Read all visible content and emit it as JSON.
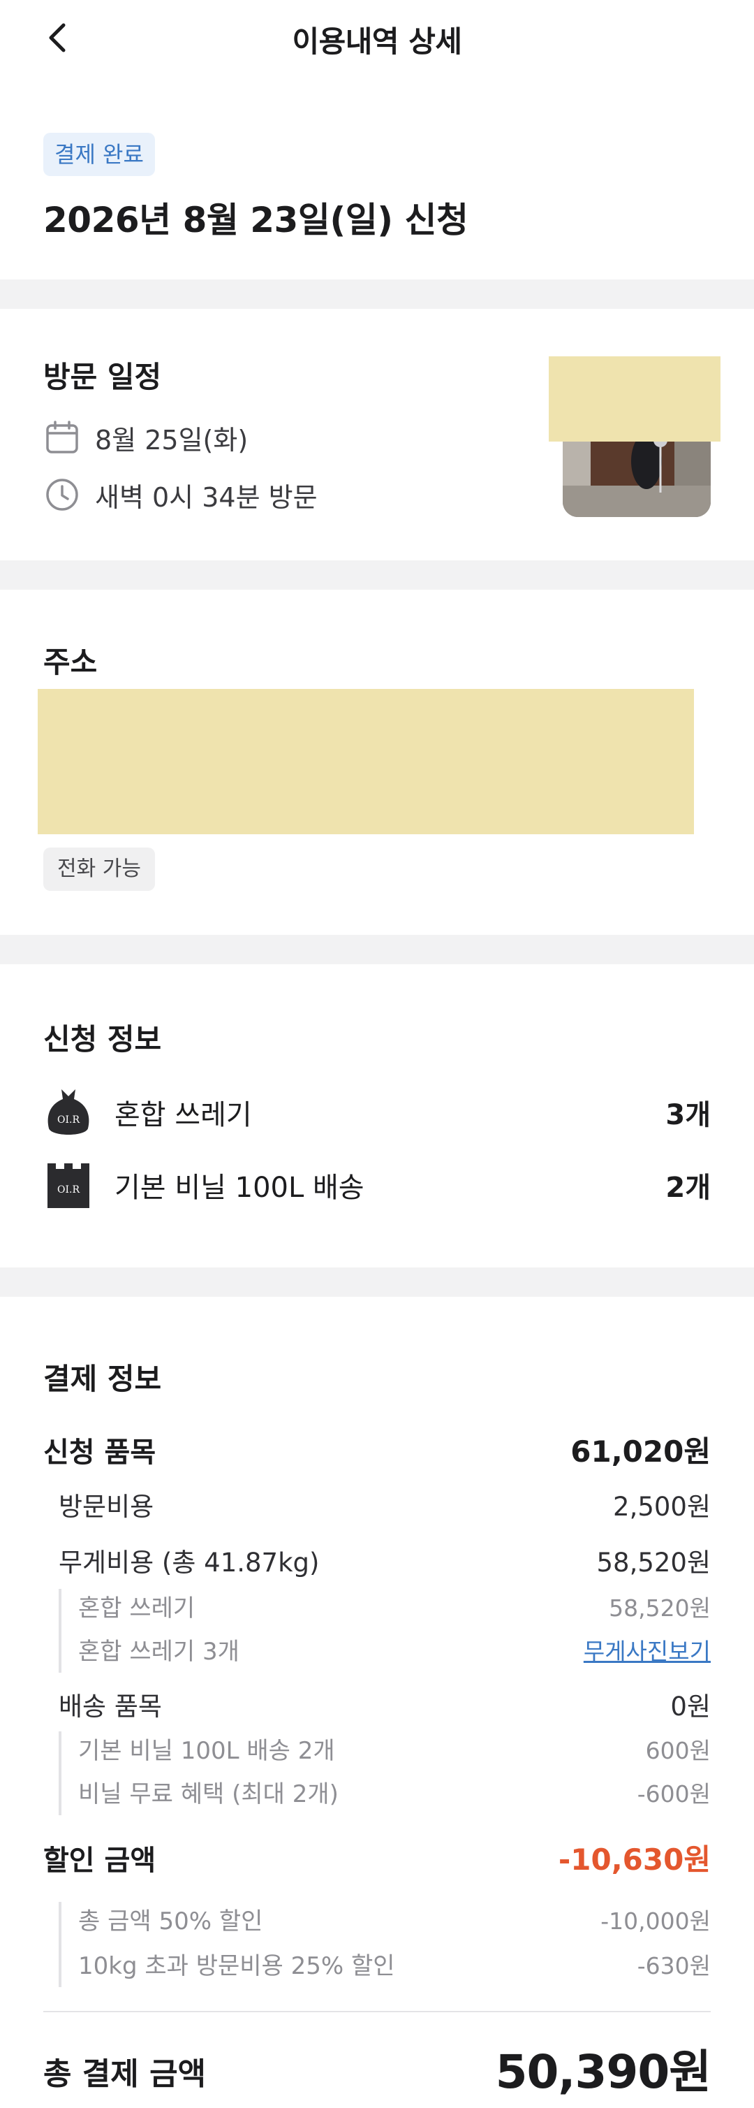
{
  "header": {
    "title": "이용내역 상세",
    "back_icon": "chevron-left-icon"
  },
  "status": {
    "badge": "결제 완료",
    "applied_date": "2026년 8월 23일(일) 신청"
  },
  "visit": {
    "section_title": "방문 일정",
    "date": "8월 25일(화)",
    "time": "새벽 0시 34분 방문",
    "date_icon": "calendar-icon",
    "time_icon": "clock-icon"
  },
  "address": {
    "section_title": "주소",
    "phone_chip": "전화 가능"
  },
  "application": {
    "section_title": "신청 정보",
    "items": [
      {
        "name": "혼합 쓰레기",
        "qty": "3개",
        "icon": "trash-bag-icon",
        "icon_text": "OI.R"
      },
      {
        "name": "기본 비닐 100L 배송",
        "qty": "2개",
        "icon": "bag-box-icon",
        "icon_text": "OI.R"
      }
    ]
  },
  "payment": {
    "section_title": "결제 정보",
    "applied_items_label": "신청 품목",
    "applied_items_value": "61,020원",
    "visit_fee_label": "방문비용",
    "visit_fee_value": "2,500원",
    "weight_fee_label": "무게비용 (총 41.87kg)",
    "weight_fee_value": "58,520원",
    "weight_detail_1_label": "혼합 쓰레기",
    "weight_detail_1_value": "58,520원",
    "weight_detail_2_label": "혼합 쓰레기 3개",
    "weight_detail_2_link": "무게사진보기",
    "delivery_label": "배송 품목",
    "delivery_value": "0원",
    "delivery_detail_1_label": "기본 비닐 100L 배송 2개",
    "delivery_detail_1_value": "600원",
    "delivery_detail_2_label": "비닐 무료 혜택 (최대 2개)",
    "delivery_detail_2_value": "-600원",
    "discount_label": "할인 금액",
    "discount_value": "-10,630원",
    "discount_detail_1_label": "총 금액 50% 할인",
    "discount_detail_1_value": "-10,000원",
    "discount_detail_2_label": "10kg 초과 방문비용 25% 할인",
    "discount_detail_2_value": "-630원",
    "total_label": "총 결제 금액",
    "total_value": "50,390원",
    "accent_color": "#e4572e",
    "link_color": "#3a78c4"
  }
}
